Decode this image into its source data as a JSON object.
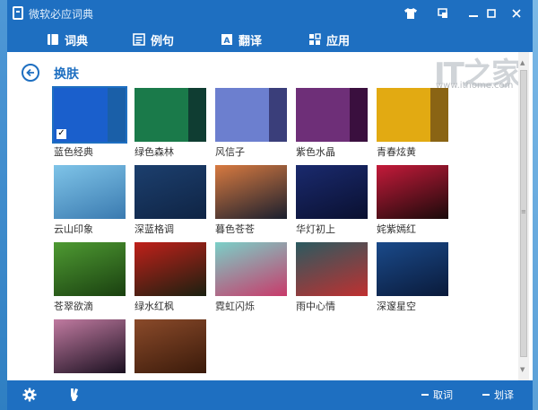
{
  "window": {
    "title": "微软必应词典",
    "titlebar_buttons": [
      "shirt-icon",
      "restore-icon",
      "minimize-icon",
      "maximize-icon",
      "close-icon"
    ]
  },
  "nav": {
    "items": [
      {
        "label": "词典",
        "icon": "book-icon"
      },
      {
        "label": "例句",
        "icon": "sentences-icon"
      },
      {
        "label": "翻译",
        "icon": "translate-icon"
      },
      {
        "label": "应用",
        "icon": "apps-icon"
      }
    ]
  },
  "page": {
    "title": "换肤",
    "back_icon": "back-arrow-icon"
  },
  "watermark": {
    "logo": "IT之家",
    "url": "www.ithome.com"
  },
  "skins": [
    {
      "label": "蓝色经典",
      "selected": true,
      "colors": [
        "#1a5fcc",
        "#1a5fa8"
      ]
    },
    {
      "label": "绿色森林",
      "selected": false,
      "colors": [
        "#1a7a4a",
        "#0f3d32"
      ]
    },
    {
      "label": "风信子",
      "selected": false,
      "colors": [
        "#6c7fcf",
        "#3a3e7a"
      ]
    },
    {
      "label": "紫色水晶",
      "selected": false,
      "colors": [
        "#6e2f78",
        "#3a0f3e"
      ]
    },
    {
      "label": "青春炫黄",
      "selected": false,
      "colors": [
        "#e2aa12",
        "#8a6414"
      ]
    },
    {
      "label": "云山印象",
      "selected": false,
      "colors": [
        "#7fc4e8",
        "#3a7ab0"
      ]
    },
    {
      "label": "深蓝格调",
      "selected": false,
      "colors": [
        "#1c3f6e",
        "#0f2444"
      ]
    },
    {
      "label": "暮色苍苍",
      "selected": false,
      "colors": [
        "#d87a40",
        "#1a1f2e"
      ]
    },
    {
      "label": "华灯初上",
      "selected": false,
      "colors": [
        "#1a2a6e",
        "#0a1030"
      ]
    },
    {
      "label": "姹紫嫣红",
      "selected": false,
      "colors": [
        "#c41a3a",
        "#1a0a0a"
      ]
    },
    {
      "label": "苍翠欲滴",
      "selected": false,
      "colors": [
        "#4e9a32",
        "#1a4010"
      ]
    },
    {
      "label": "绿水红枫",
      "selected": false,
      "colors": [
        "#c0201a",
        "#1a2010"
      ]
    },
    {
      "label": "霓虹闪烁",
      "selected": false,
      "colors": [
        "#7ad0c8",
        "#c83a6a"
      ]
    },
    {
      "label": "雨中心情",
      "selected": false,
      "colors": [
        "#2a5a60",
        "#c03030"
      ]
    },
    {
      "label": "深邃星空",
      "selected": false,
      "colors": [
        "#1a4a8a",
        "#0a1a3a"
      ]
    },
    {
      "label": "",
      "selected": false,
      "colors": [
        "#c07aa0",
        "#1a1020"
      ]
    },
    {
      "label": "",
      "selected": false,
      "colors": [
        "#8a4a2a",
        "#3a1a0a"
      ]
    }
  ],
  "bottom": {
    "left_icons": [
      "gear-icon",
      "brush-icon"
    ],
    "word_pick": "取词",
    "select_translate": "划译"
  }
}
